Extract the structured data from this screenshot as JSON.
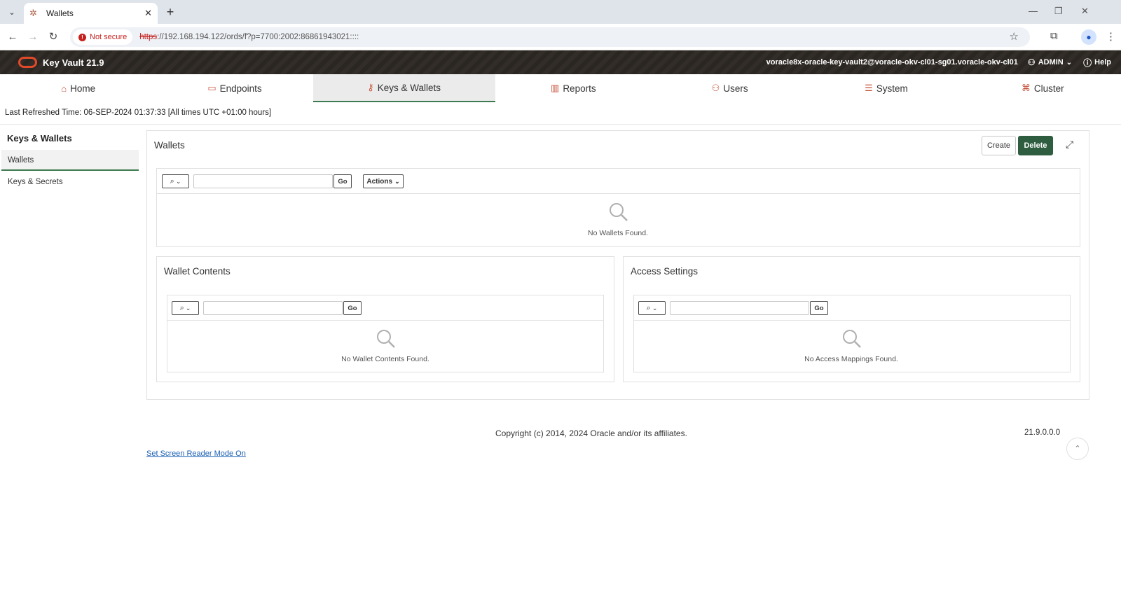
{
  "browser": {
    "tab_title": "Wallets",
    "tab_close": "✕",
    "new_tab": "+",
    "security_label": "Not secure",
    "url_protocol": "https",
    "url_rest": "://192.168.194.122/ords/f?p=7700:2002:86861943021::::",
    "window_min": "—",
    "window_restore": "❐",
    "window_close": "✕"
  },
  "header": {
    "app_title": "Key Vault 21.9",
    "hostname": "voracle8x-oracle-key-vault2@voracle-okv-cl01-sg01.voracle-okv-cl01",
    "user": "ADMIN",
    "help": "Help"
  },
  "nav": {
    "items": [
      {
        "label": "Home",
        "icon": "home-icon"
      },
      {
        "label": "Endpoints",
        "icon": "monitor-icon"
      },
      {
        "label": "Keys & Wallets",
        "icon": "key-icon"
      },
      {
        "label": "Reports",
        "icon": "bar-chart-icon"
      },
      {
        "label": "Users",
        "icon": "users-icon"
      },
      {
        "label": "System",
        "icon": "system-icon"
      },
      {
        "label": "Cluster",
        "icon": "cluster-icon"
      }
    ],
    "active_index": 2
  },
  "refresh_text": "Last Refreshed Time: 06-SEP-2024 01:37:33 [All times UTC +01:00 hours]",
  "sidebar": {
    "title": "Keys & Wallets",
    "items": [
      {
        "label": "Wallets",
        "active": true
      },
      {
        "label": "Keys & Secrets",
        "active": false
      }
    ]
  },
  "wallets": {
    "title": "Wallets",
    "create_label": "Create",
    "delete_label": "Delete",
    "go_label": "Go",
    "actions_label": "Actions",
    "empty_message": "No Wallets Found."
  },
  "wallet_contents": {
    "title": "Wallet Contents",
    "go_label": "Go",
    "empty_message": "No Wallet Contents Found."
  },
  "access_settings": {
    "title": "Access Settings",
    "go_label": "Go",
    "empty_message": "No Access Mappings Found."
  },
  "footer": {
    "copyright": "Copyright (c) 2014, 2024 Oracle and/or its affiliates.",
    "version": "21.9.0.0.0",
    "screen_reader_link": "Set Screen Reader Mode On"
  },
  "colors": {
    "accent_green": "#2f5d3f",
    "nav_icon": "#c7533a",
    "header_bg": "#2a2622"
  }
}
